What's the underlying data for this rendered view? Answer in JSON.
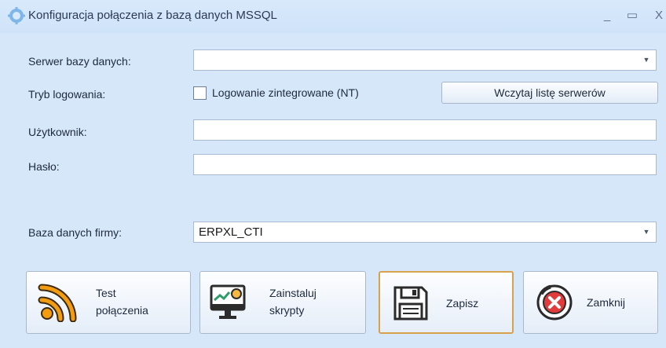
{
  "window": {
    "title": "Konfiguracja połączenia z bazą danych MSSQL",
    "controls": {
      "minimize": "_",
      "maximize": "▭",
      "close": "X"
    }
  },
  "form": {
    "server": {
      "label": "Serwer bazy danych:",
      "value": ""
    },
    "login_mode": {
      "label": "Tryb logowania:",
      "checkbox_label": "Logowanie zintegrowane (NT)",
      "checked": false,
      "load_servers_button": "Wczytaj listę serwerów"
    },
    "user": {
      "label": "Użytkownik:",
      "value": ""
    },
    "password": {
      "label": "Hasło:",
      "value": ""
    },
    "company_db": {
      "label": "Baza danych firmy:",
      "value": "ERPXL_CTI"
    }
  },
  "buttons": {
    "test": {
      "line1": "Test",
      "line2": "połączenia",
      "icon": "rss-icon"
    },
    "install": {
      "line1": "Zainstaluj",
      "line2": "skrypty",
      "icon": "monitor-chart-icon"
    },
    "save": {
      "label": "Zapisz",
      "icon": "floppy-disk-icon"
    },
    "close": {
      "label": "Zamknij",
      "icon": "close-circle-icon"
    }
  },
  "colors": {
    "window_bg": "#d6e7fa",
    "accent_orange": "#f39c12",
    "close_red": "#e23b3b",
    "focus_border": "#d7a24b"
  }
}
